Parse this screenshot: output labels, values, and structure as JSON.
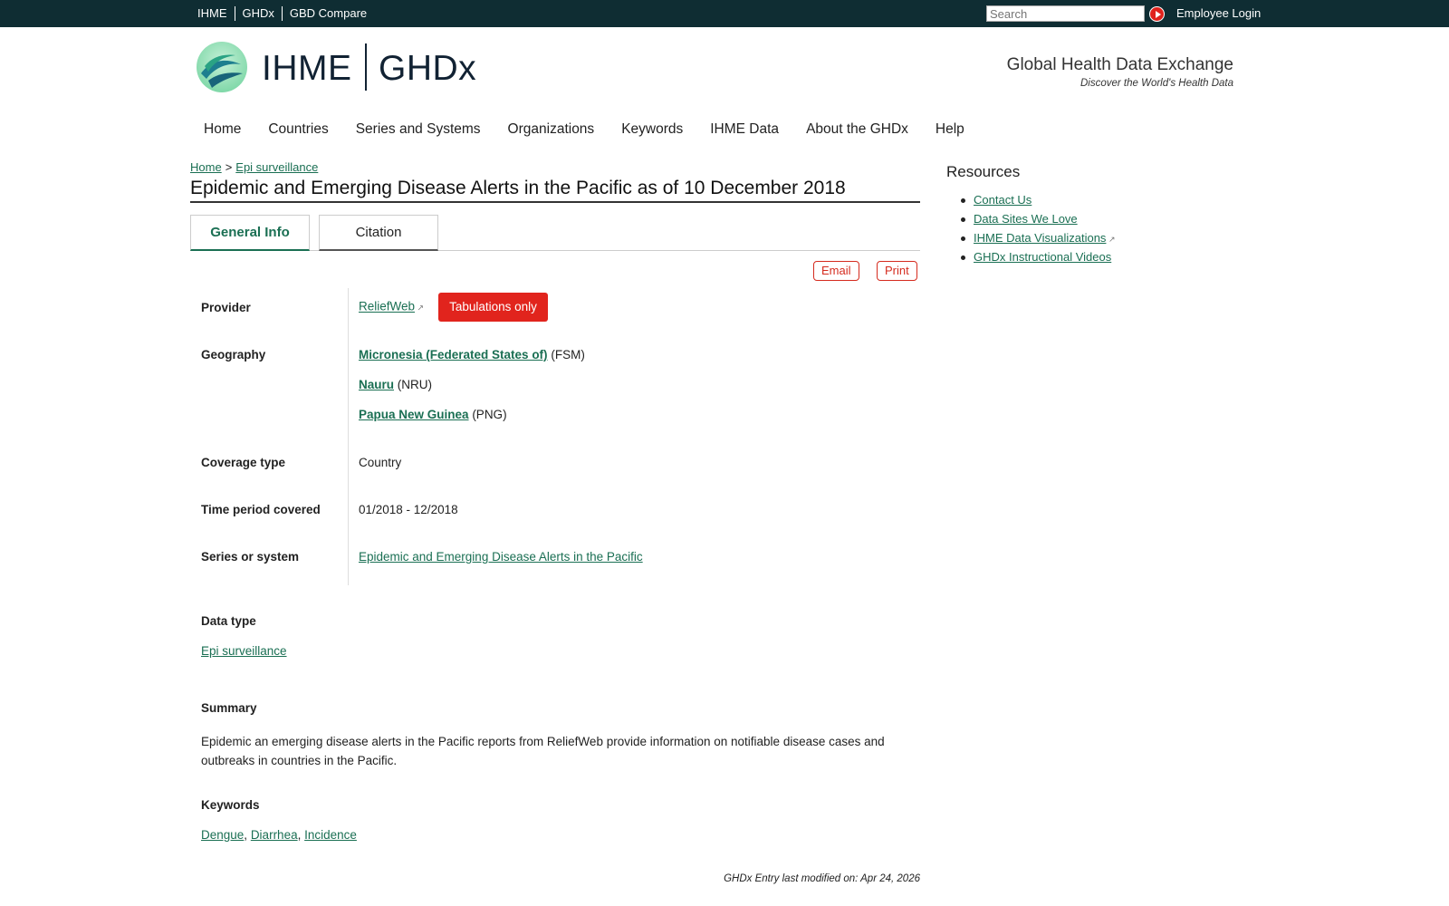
{
  "topbar": {
    "links": [
      "IHME",
      "GHDx",
      "GBD Compare"
    ],
    "search_placeholder": "Search",
    "login_label": "Employee Login"
  },
  "header": {
    "logo_left": "IHME",
    "logo_right": "GHDx",
    "tagline": "Global Health Data Exchange",
    "subtagline": "Discover the World's Health Data"
  },
  "nav": [
    "Home",
    "Countries",
    "Series and Systems",
    "Organizations",
    "Keywords",
    "IHME Data",
    "About the GHDx",
    "Help"
  ],
  "breadcrumb": {
    "home": "Home",
    "sep": ">",
    "current": "Epi surveillance"
  },
  "page_title": "Epidemic and Emerging Disease Alerts in the Pacific as of 10 December 2018",
  "tabs": {
    "general": "General Info",
    "citation": "Citation"
  },
  "actions": {
    "email": "Email",
    "print": "Print"
  },
  "fields": {
    "provider_label": "Provider",
    "provider_value": "ReliefWeb",
    "provider_badge": "Tabulations only",
    "geography_label": "Geography",
    "geography": [
      {
        "name": "Micronesia (Federated States of)",
        "code": "(FSM)"
      },
      {
        "name": "Nauru",
        "code": "(NRU)"
      },
      {
        "name": "Papua New Guinea",
        "code": "(PNG)"
      }
    ],
    "coverage_label": "Coverage type",
    "coverage_value": "Country",
    "time_label": "Time period covered",
    "time_value": "01/2018 - 12/2018",
    "series_label": "Series or system",
    "series_value": "Epidemic and Emerging Disease Alerts in the Pacific"
  },
  "data_type": {
    "heading": "Data type",
    "value": "Epi surveillance"
  },
  "summary": {
    "heading": "Summary",
    "text": "Epidemic an emerging disease alerts in the Pacific reports from ReliefWeb provide information on notifiable disease cases and outbreaks in countries in the Pacific."
  },
  "keywords": {
    "heading": "Keywords",
    "items": [
      "Dengue",
      "Diarrhea",
      "Incidence"
    ]
  },
  "modified": "GHDx Entry last modified on: Apr 24, 2026",
  "resources": {
    "heading": "Resources",
    "items": [
      "Contact Us",
      "Data Sites We Love",
      "IHME Data Visualizations",
      "GHDx Instructional Videos"
    ]
  },
  "colors": {
    "topbar": "#0f2d33",
    "link": "#1a6f53",
    "accent_red": "#e1241d"
  }
}
